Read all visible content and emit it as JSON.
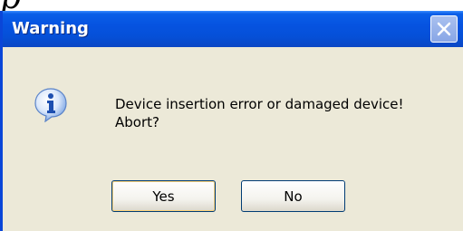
{
  "background_glyph": "p",
  "dialog": {
    "title": "Warning",
    "icon": "information-icon",
    "message_line1": "Device insertion error or damaged device!",
    "message_line2": "Abort?",
    "buttons": {
      "yes": "Yes",
      "no": "No"
    },
    "close_icon": "close-icon"
  },
  "colors": {
    "titlebar": "#0653e0",
    "window_body": "#ece9d8",
    "button_border": "#003c74",
    "default_button_focus": "#f8d07a"
  }
}
